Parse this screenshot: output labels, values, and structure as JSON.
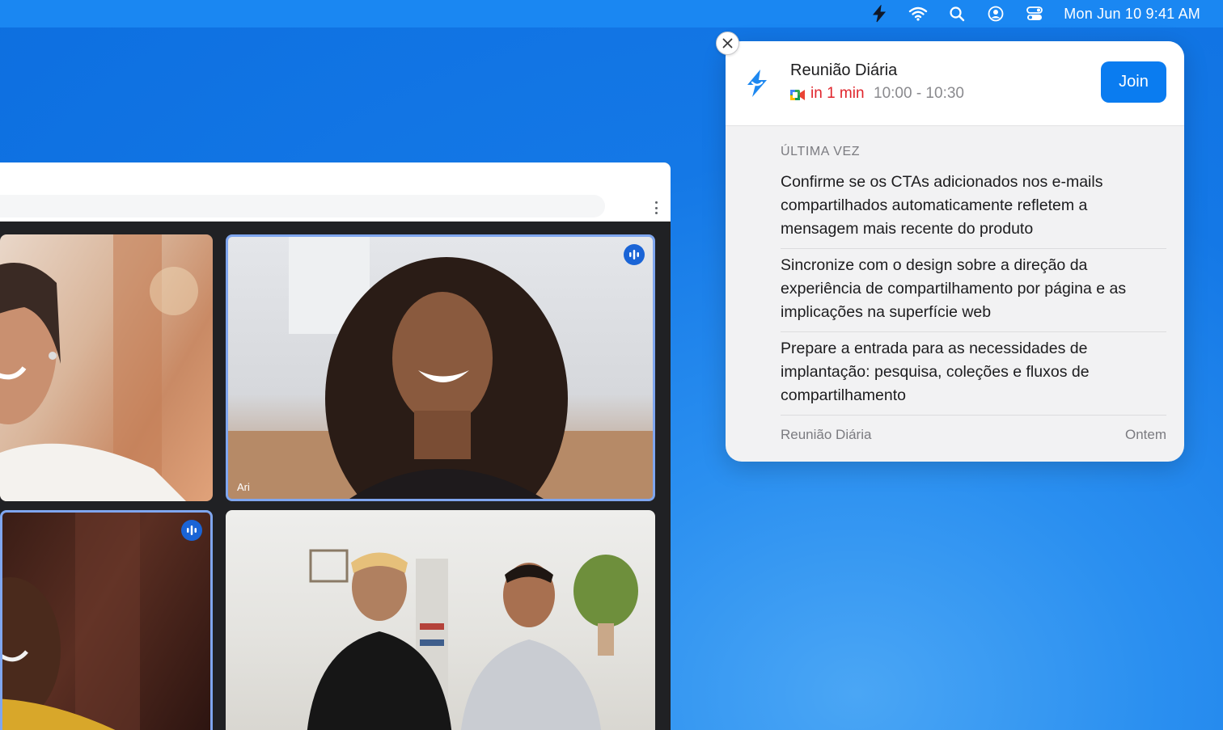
{
  "menubar": {
    "icons": [
      "lightning-app-icon",
      "wifi-icon",
      "search-icon",
      "user-circle-icon",
      "control-center-icon"
    ],
    "clock": "Mon Jun 10  9:41 AM"
  },
  "meeting_window": {
    "participants": [
      {
        "name": "",
        "speaking": false
      },
      {
        "name": "Ari",
        "speaking": true
      },
      {
        "name": "",
        "speaking": true
      },
      {
        "name": "",
        "speaking": false
      }
    ]
  },
  "notification": {
    "title": "Reunião Diária",
    "starts_in": "in 1 min",
    "time_range": "10:00 - 10:30",
    "join_label": "Join",
    "section_label": "ÚLTIMA VEZ",
    "notes": [
      "Confirme se os CTAs adicionados nos e-mails compartilhados automaticamente refletem a mensagem mais recente do produto",
      "Sincronize com o design sobre a direção da experiência de compartilhamento por página e as implicações na superfície web",
      "Prepare a entrada para as necessidades de implantação: pesquisa, coleções e fluxos de compartilhamento"
    ],
    "footer_source": "Reunião Diária",
    "footer_date": "Ontem",
    "accent_color": "#0a7cf0",
    "alert_color": "#e0252c"
  }
}
